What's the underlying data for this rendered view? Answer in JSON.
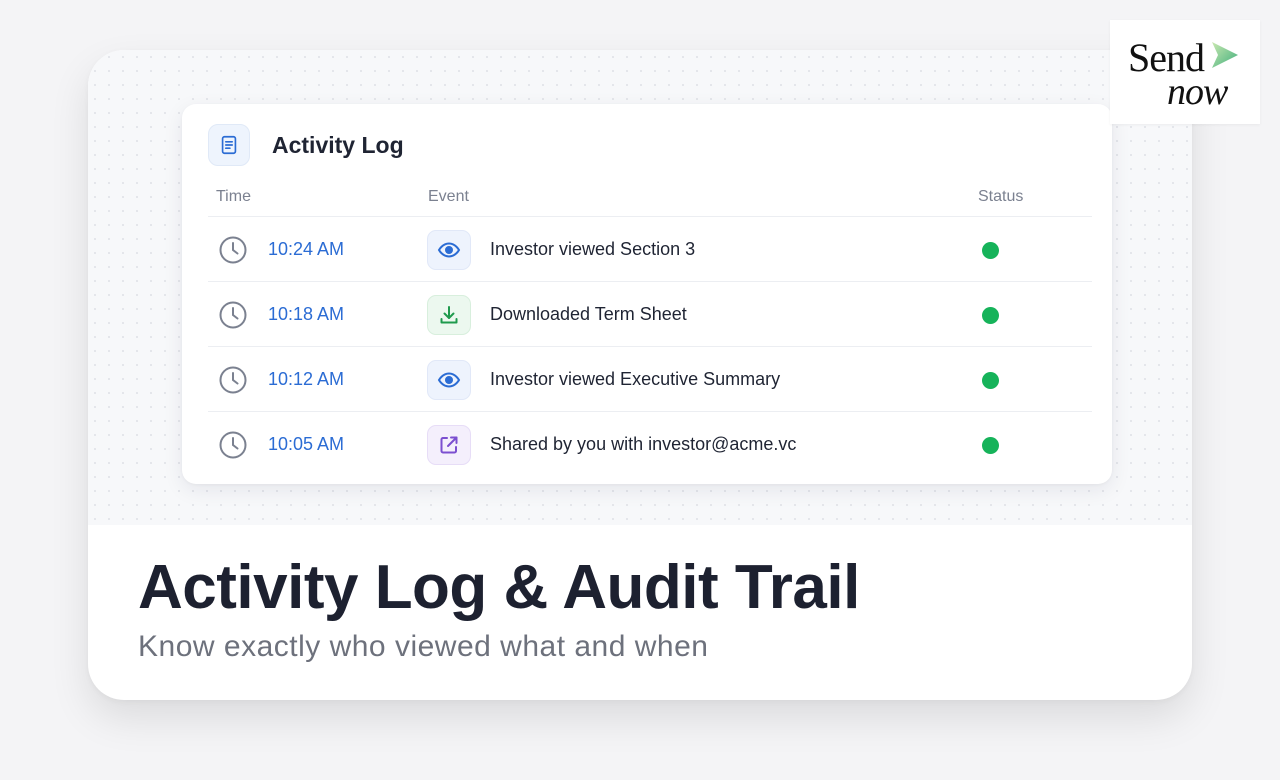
{
  "panel": {
    "title": "Activity Log",
    "columns": {
      "time": "Time",
      "event": "Event",
      "status": "Status"
    },
    "rows": [
      {
        "time": "10:24 AM",
        "event": "Investor viewed Section 3",
        "icon": "eye-icon",
        "status_color": "#16b35a"
      },
      {
        "time": "10:18 AM",
        "event": "Downloaded Term Sheet",
        "icon": "download-icon",
        "status_color": "#16b35a"
      },
      {
        "time": "10:12 AM",
        "event": "Investor viewed Executive Summary",
        "icon": "eye-icon",
        "status_color": "#16b35a"
      },
      {
        "time": "10:05 AM",
        "event": "Shared by you with investor@acme.vc",
        "icon": "share-external-icon",
        "status_color": "#16b35a"
      }
    ]
  },
  "hero": {
    "headline": "Activity Log & Audit Trail",
    "subheadline": "Know exactly who viewed what and when"
  },
  "logo": {
    "word1": "Send",
    "word2": "now"
  },
  "colors": {
    "accent_blue": "#2b6cd4",
    "status_green": "#16b35a",
    "heading": "#1d2130"
  }
}
